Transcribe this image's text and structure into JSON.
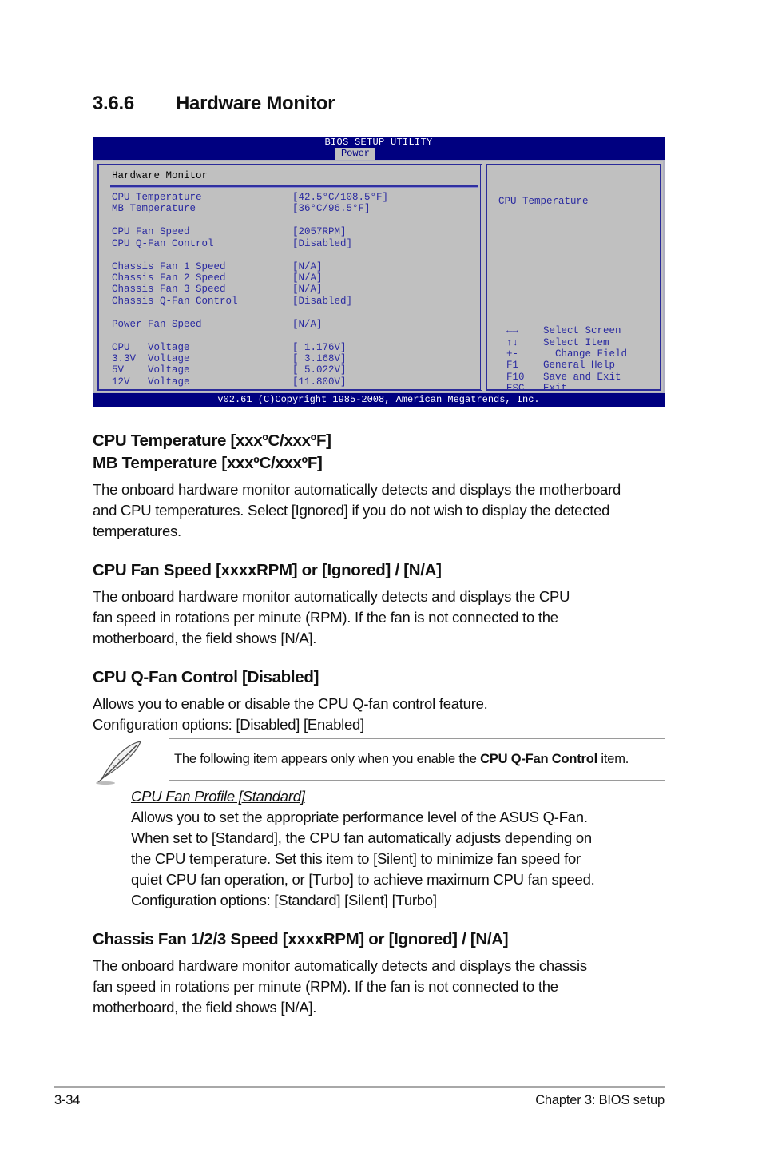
{
  "section": {
    "number": "3.6.6",
    "title": "Hardware Monitor"
  },
  "bios": {
    "title": "BIOS SETUP UTILITY",
    "active_tab": "Power",
    "panel_heading": "Hardware Monitor",
    "items": [
      {
        "label": "CPU Temperature",
        "value": "[42.5°C/108.5°F]"
      },
      {
        "label": "MB Temperature",
        "value": "[36°C/96.5°F]"
      },
      {
        "label": "CPU Fan Speed",
        "value": "[2057RPM]"
      },
      {
        "label": "CPU Q-Fan Control",
        "value": "[Disabled]"
      },
      {
        "label": "Chassis Fan 1 Speed",
        "value": "[N/A]"
      },
      {
        "label": "Chassis Fan 2 Speed",
        "value": "[N/A]"
      },
      {
        "label": "Chassis Fan 3 Speed",
        "value": "[N/A]"
      },
      {
        "label": "Chassis Q-Fan Control",
        "value": "[Disabled]"
      },
      {
        "label": "Power Fan Speed",
        "value": "[N/A]"
      },
      {
        "label": "CPU   Voltage",
        "value": "[ 1.176V]"
      },
      {
        "label": "3.3V  Voltage",
        "value": "[ 3.168V]"
      },
      {
        "label": "5V    Voltage",
        "value": "[ 5.022V]"
      },
      {
        "label": "12V   Voltage",
        "value": "[11.800V]"
      }
    ],
    "help_text": "CPU Temperature",
    "keys": [
      {
        "key": "←→",
        "action": "Select Screen"
      },
      {
        "key": "↑↓",
        "action": "Select Item"
      },
      {
        "key": "+-",
        "action": "  Change Field"
      },
      {
        "key": "F1",
        "action": "General Help"
      },
      {
        "key": "F10",
        "action": "Save and Exit"
      },
      {
        "key": "ESC",
        "action": "Exit"
      }
    ],
    "footer": "v02.61 (C)Copyright 1985-2008, American Megatrends, Inc."
  },
  "content": {
    "temp_heading_1": "CPU Temperature [xxxºC/xxxºF]",
    "temp_heading_2": "MB Temperature [xxxºC/xxxºF]",
    "temp_body": [
      "The onboard hardware monitor automatically detects and displays the motherboard",
      "and CPU temperatures. Select [Ignored] if you do not wish to display the detected",
      "temperatures."
    ],
    "cpufan_heading": "CPU Fan Speed [xxxxRPM] or [Ignored] / [N/A]",
    "cpufan_body": [
      "The onboard hardware monitor automatically detects and displays the CPU",
      "fan speed in rotations per minute (RPM). If the fan is not connected to the",
      "motherboard, the field shows [N/A]."
    ],
    "qfan_heading": "CPU Q-Fan Control [Disabled]",
    "qfan_body": [
      "Allows you to enable or disable the CPU Q-fan control feature.",
      "Configuration options: [Disabled] [Enabled]"
    ],
    "note": {
      "pre": "The following item appears only when you enable the ",
      "bold": "CPU Q-Fan Control",
      "post": " item."
    },
    "profile_heading": "CPU Fan Profile [Standard]",
    "profile_body": [
      "Allows you to set the appropriate performance level of the ASUS Q-Fan.",
      "When set to [Standard], the CPU fan automatically adjusts depending on",
      "the CPU temperature. Set this item to [Silent] to minimize fan speed for",
      "quiet CPU fan operation, or [Turbo] to achieve maximum CPU fan speed.",
      "Configuration options: [Standard] [Silent] [Turbo]"
    ],
    "chassis_heading": "Chassis Fan 1/2/3 Speed [xxxxRPM] or [Ignored] / [N/A]",
    "chassis_body": [
      "The onboard hardware monitor automatically detects and displays the chassis",
      "fan speed in rotations per minute (RPM). If the fan is not connected to the",
      "motherboard, the field shows [N/A]."
    ]
  },
  "footer": {
    "page": "3-34",
    "chapter": "Chapter 3: BIOS setup"
  }
}
